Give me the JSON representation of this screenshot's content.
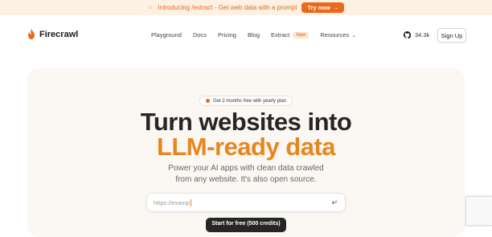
{
  "announcement": {
    "text": "Introducing /extract - Get web data with a prompt",
    "button_label": "Try now",
    "button_arrow": "→",
    "icon": "sparkle-icon"
  },
  "nav": {
    "brand": "Firecrawl",
    "links": [
      "Playground",
      "Docs",
      "Pricing",
      "Blog",
      "Extract"
    ],
    "extract_badge": "New",
    "resources_label": "Resources",
    "github_stars": "34.3k",
    "signup_label": "Sign Up"
  },
  "hero": {
    "badge": "Get 2 months free with yearly plan",
    "headline_line1": "Turn websites into",
    "headline_line2": "LLM-ready data",
    "subtitle_line1": "Power your AI apps with clean data crawled",
    "subtitle_line2": "from any website. It's also open source.",
    "input_value": "https://examp",
    "enter_symbol": "↵",
    "cta_label": "Start for free (500 credits)"
  },
  "colors": {
    "accent": "#e8861e",
    "announce_bg": "#fdf1e4",
    "hero_bg": "#fbf8f4"
  }
}
